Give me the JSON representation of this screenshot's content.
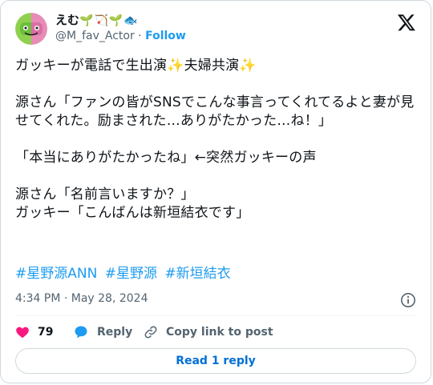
{
  "author": {
    "display_name": "えむ",
    "display_emoji": "🌱🏹🌱🐟",
    "handle": "@M_fav_Actor",
    "separator": "·",
    "follow_label": "Follow"
  },
  "tweet": {
    "text": "ガッキーが電話で生出演✨夫婦共演✨\n\n源さん「ファンの皆がSNSでこんな事言ってくれてるよと妻が見せてくれた。励まされた…ありがたかった…ね！」\n\n「本当にありがたかったね」←突然ガッキーの声\n\n源さん「名前言いますか？」\nガッキー「こんばんは新垣結衣です」",
    "hashtags": [
      "#星野源ANN",
      "#星野源",
      "#新垣結衣"
    ],
    "timestamp": "4:34 PM · May 28, 2024"
  },
  "actions": {
    "like_count": "79",
    "reply_label": "Reply",
    "copy_label": "Copy link to post"
  },
  "read_replies_label": "Read 1 reply",
  "colors": {
    "accent": "#1d9bf0",
    "like": "#f91880",
    "muted": "#536471",
    "border": "#cfd9de"
  }
}
